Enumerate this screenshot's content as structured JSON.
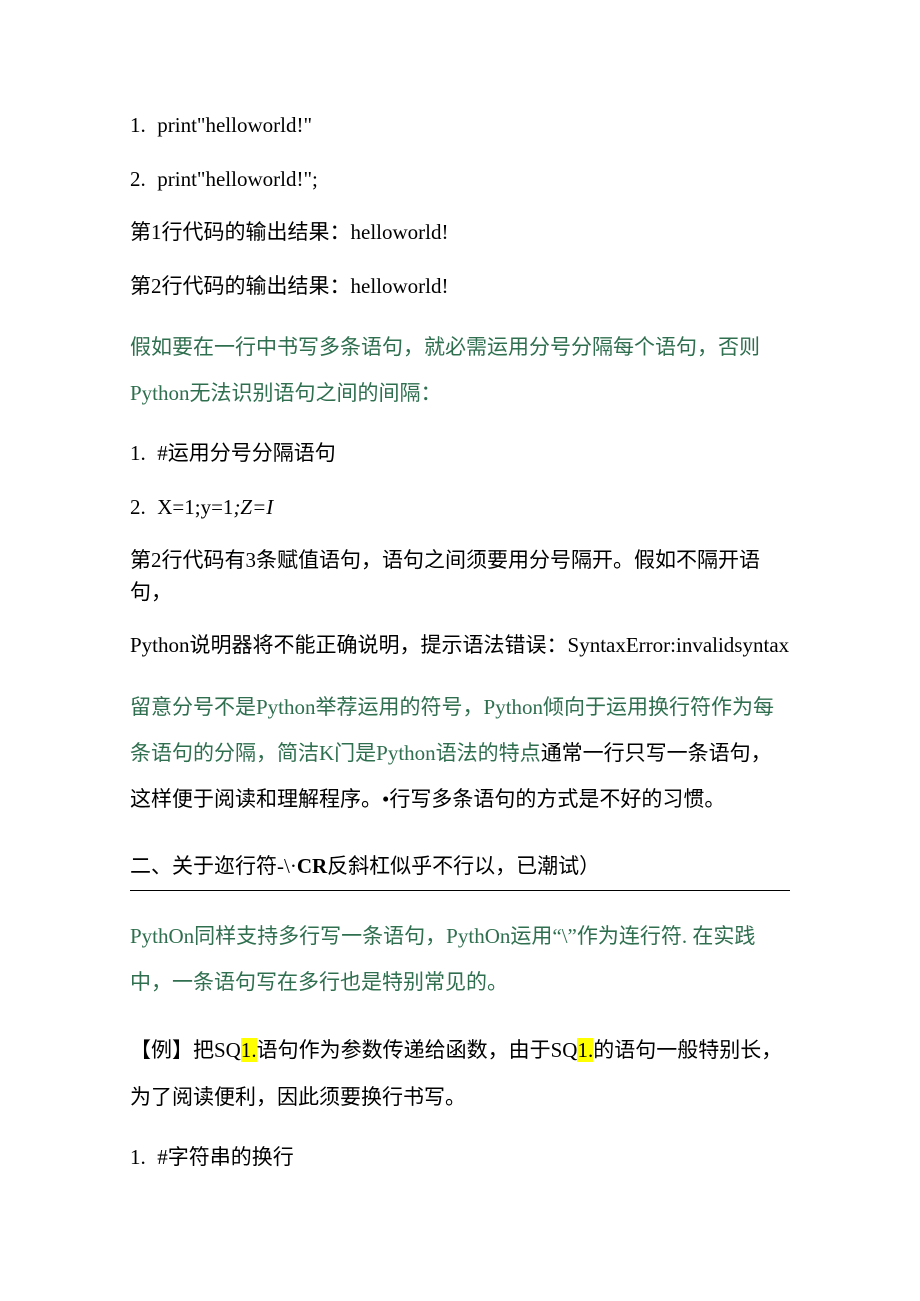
{
  "code1": {
    "n1": "1.",
    "t1": "print\"helloworld!\"",
    "n2": "2.",
    "t2": "print\"helloworld!\";"
  },
  "out1": "第1行代码的输出结果：helloworld!",
  "out2": "第2行代码的输出结果：helloworld!",
  "green1": "假如要在一行中书写多条语句，就必需运用分号分隔每个语句，否则Python无法识别语句之间的间隔：",
  "code2": {
    "n1": "1.",
    "t1": "#运用分号分隔语句",
    "n2": "2.",
    "t2a": "X=1;y=1",
    "t2b": ";Z=I"
  },
  "para2": "第2行代码有3条赋值语句，语句之间须要用分号隔开。假如不隔开语句，",
  "para3": "Python说明器将不能正确说明，提示语法错误：SyntaxError:invalidsyntax",
  "green2a": "留意分号不是Python举荐运用的符号，Python倾向于运用换行符作为每条语句的分隔，简洁K门是Python语法的特点",
  "green2b": "通常一行只写一条语句，这样便于阅读和理解程序。•行写多条语句的方式是不好的习惯。",
  "heading": {
    "pre": "二、关于迩行符-\\·",
    "bold": "CR",
    "post": "反斜杠似乎不行以，已潮试）"
  },
  "green3": "PythOn同样支持多行写一条语句，PythOn运用“\\”作为连行符. 在实践中，一条语句写在多行也是特别常见的。",
  "sql": {
    "a": "【例】把SQ",
    "h1": "1.",
    "b": "语句作为参数传递给函数，由于SQ",
    "h2": "1.",
    "c": "的语句一般特别长，为了阅读便利，因此须要换行书写。"
  },
  "code3": {
    "n1": "1.",
    "t1": "#字符串的换行"
  }
}
